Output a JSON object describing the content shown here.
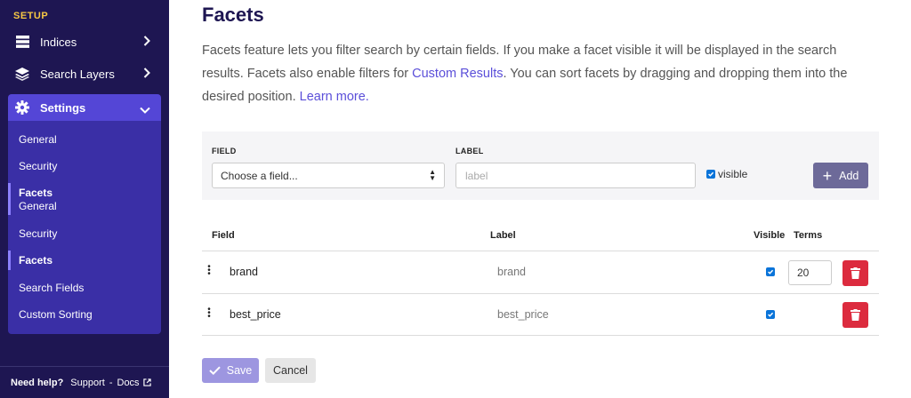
{
  "sidebar": {
    "section_label": "SETUP",
    "items": [
      {
        "label": "Indices",
        "icon": "indices-icon"
      },
      {
        "label": "Search Layers",
        "icon": "layers-icon"
      },
      {
        "label": "Settings",
        "icon": "gear-icon"
      }
    ],
    "submenu": [
      "General",
      "Security",
      "Facets",
      "General",
      "Security",
      "Facets",
      "Search Fields",
      "Custom Sorting"
    ],
    "help": {
      "label": "Need help?",
      "support": "Support",
      "separator": "-",
      "docs": "Docs"
    }
  },
  "page": {
    "title": "Facets",
    "desc_1": "Facets feature lets you filter search by certain fields. If you make a facet visible it will be displayed in the search results. Facets also enable filters for ",
    "desc_link_1": "Custom Results",
    "desc_2": ". You can sort facets by dragging and dropping them into the desired position. ",
    "desc_link_2": "Learn more."
  },
  "form": {
    "field_label": "FIELD",
    "field_value": "Choose a field...",
    "label_label": "LABEL",
    "label_placeholder": "label",
    "visible_label": "visible",
    "visible_checked": true,
    "add_label": "Add"
  },
  "table": {
    "headers": {
      "field": "Field",
      "label": "Label",
      "visible": "Visible",
      "terms": "Terms"
    },
    "rows": [
      {
        "field": "brand",
        "label": "brand",
        "visible": true,
        "terms": "20"
      },
      {
        "field": "best_price",
        "label": "best_price",
        "visible": true,
        "terms": ""
      }
    ]
  },
  "actions": {
    "save": "Save",
    "cancel": "Cancel"
  },
  "colors": {
    "sidebar_bg": "#1e1652",
    "accent": "#5446d6",
    "danger": "#dc2b3e",
    "section_label": "#f6c744",
    "link": "#5b4fd9"
  }
}
